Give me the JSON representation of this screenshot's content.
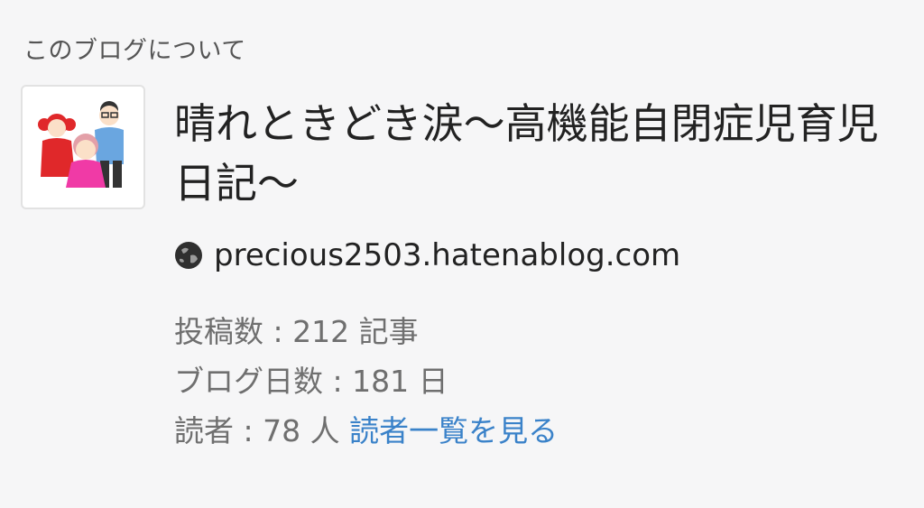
{
  "section": {
    "heading": "このブログについて"
  },
  "blog": {
    "icon": "family-illustration-icon",
    "title": "晴れときどき涙〜高機能自閉症児育児日記〜",
    "url_icon": "globe-icon",
    "url": "precious2503.hatenablog.com"
  },
  "stats": {
    "posts": "投稿数 : 212 記事",
    "days": "ブログ日数 : 181 日",
    "readers": "読者 : 78 人",
    "readers_link": "読者一覧を見る"
  },
  "colors": {
    "background": "#f6f6f7",
    "link": "#3a82c9",
    "title": "#222222",
    "muted": "#6f6f6f"
  }
}
